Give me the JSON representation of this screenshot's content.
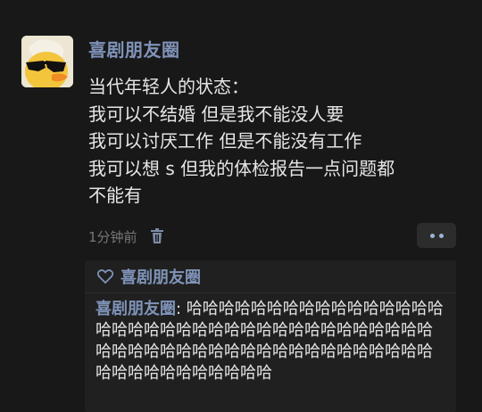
{
  "post": {
    "author": "喜剧朋友圈",
    "lines": [
      "当代年轻人的状态：",
      "我可以不结婚 但是我不能没人要",
      "我可以讨厌工作 但是不能没有工作",
      "我可以想 s 但我的体检报告一点问题都",
      "不能有"
    ],
    "time": "1分钟前"
  },
  "likes": {
    "names": "喜剧朋友圈"
  },
  "comment": {
    "author": "喜剧朋友圈",
    "separator": ": ",
    "text": "哈哈哈哈哈哈哈哈哈哈哈哈哈哈哈哈哈哈哈哈哈哈哈哈哈哈哈哈哈哈哈哈哈哈哈哈哈哈哈哈哈哈哈哈哈哈哈哈哈哈哈哈哈哈哈哈哈哈哈哈哈哈哈哈哈哈哈哈哈"
  },
  "colors": {
    "background": "#181818",
    "name_link": "#7f93b8",
    "comment_panel": "#202020"
  },
  "icons": [
    "avatar-duck-sunglasses",
    "trash-icon",
    "more-dots-icon",
    "heart-outline-icon"
  ]
}
